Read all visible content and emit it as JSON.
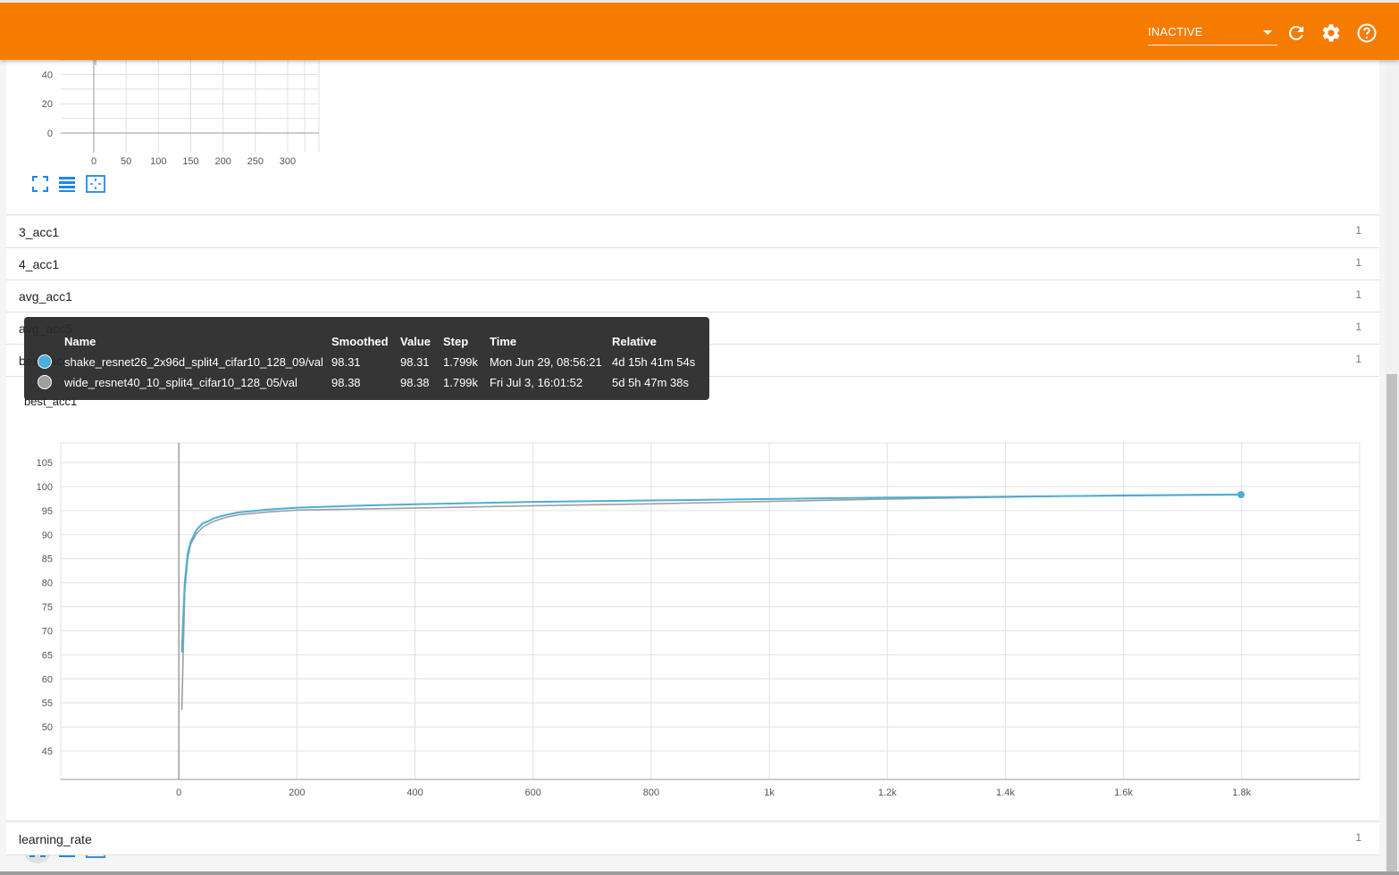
{
  "header": {
    "status_value": "INACTIVE",
    "accent_color": "#f57c00",
    "icons": [
      "refresh-icon",
      "gear-icon",
      "help-icon"
    ]
  },
  "top_chart": {
    "y_ticks": [
      "40",
      "20",
      "0"
    ],
    "x_ticks": [
      "0",
      "50",
      "100",
      "150",
      "200",
      "250",
      "300"
    ]
  },
  "rows": [
    {
      "label": "3_acc1",
      "count": "1"
    },
    {
      "label": "4_acc1",
      "count": "1"
    },
    {
      "label": "avg_acc1",
      "count": "1"
    },
    {
      "label": "avg_acc5",
      "count": "1"
    },
    {
      "label": "best_acc1",
      "count": "1"
    }
  ],
  "main_chart_title": "best_acc1",
  "learning_rate_row": {
    "label": "learning_rate",
    "count": "1"
  },
  "tooltip": {
    "headers": [
      "Name",
      "Smoothed",
      "Value",
      "Step",
      "Time",
      "Relative"
    ],
    "rows": [
      {
        "color": "#4cadd9",
        "name": "shake_resnet26_2x96d_split4_cifar10_128_09/val",
        "smoothed": "98.31",
        "value": "98.31",
        "step": "1.799k",
        "time": "Mon Jun 29, 08:56:21",
        "relative": "4d 15h 41m 54s"
      },
      {
        "color": "#9e9e9e",
        "name": "wide_resnet40_10_split4_cifar10_128_05/val",
        "smoothed": "98.38",
        "value": "98.38",
        "step": "1.799k",
        "time": "Fri Jul 3, 16:01:52",
        "relative": "5d 5h 47m 38s"
      }
    ]
  },
  "chart_data": {
    "type": "line",
    "x_ticks": [
      "0",
      "200",
      "400",
      "600",
      "800",
      "1k",
      "1.2k",
      "1.4k",
      "1.6k",
      "1.8k"
    ],
    "y_ticks": [
      "45",
      "50",
      "55",
      "60",
      "65",
      "70",
      "75",
      "80",
      "85",
      "90",
      "95",
      "100",
      "105"
    ],
    "xlim": [
      -200,
      2000
    ],
    "ylim": [
      40,
      108
    ],
    "series": [
      {
        "name": "shake_resnet26_2x96d_split4_cifar10_128_09/val",
        "color": "#4cadd9",
        "x": [
          5,
          10,
          15,
          20,
          30,
          40,
          50,
          60,
          80,
          100,
          150,
          200,
          300,
          400,
          600,
          800,
          1000,
          1200,
          1400,
          1600,
          1799
        ],
        "y": [
          65.5,
          80,
          86,
          88.5,
          91,
          92.3,
          92.8,
          93.4,
          94.1,
          94.6,
          95.2,
          95.6,
          96,
          96.3,
          96.8,
          97.1,
          97.4,
          97.7,
          97.9,
          98.1,
          98.31
        ]
      },
      {
        "name": "wide_resnet40_10_split4_cifar10_128_05/val",
        "color": "#9e9e9e",
        "x": [
          5,
          10,
          15,
          20,
          30,
          40,
          50,
          60,
          80,
          100,
          150,
          200,
          300,
          400,
          600,
          800,
          1000,
          1200,
          1400,
          1600,
          1799
        ],
        "y": [
          53.5,
          78,
          85,
          88,
          90.2,
          91.5,
          92.2,
          92.8,
          93.6,
          94.1,
          94.7,
          95.1,
          95.3,
          95.5,
          96,
          96.4,
          96.9,
          97.4,
          97.8,
          98.2,
          98.38
        ]
      }
    ]
  }
}
